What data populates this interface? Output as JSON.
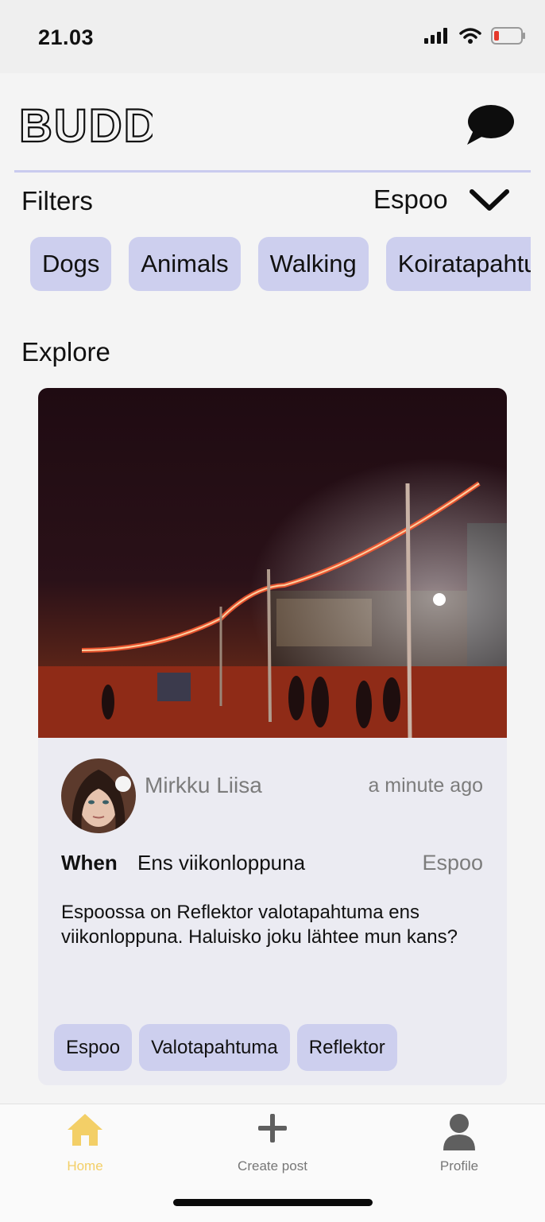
{
  "status_bar": {
    "time": "21.03",
    "icons": [
      "cellular-signal-icon",
      "wifi-icon",
      "battery-low-icon"
    ]
  },
  "header": {
    "logo_text": "BUDDY",
    "chat_icon": "chat-bubble-icon"
  },
  "filters": {
    "label": "Filters",
    "location": "Espoo",
    "chips": [
      "Dogs",
      "Animals",
      "Walking",
      "Koiratapahtuma"
    ]
  },
  "explore": {
    "label": "Explore",
    "post": {
      "image": "night-street-lights-photo",
      "author": "Mirkku Liisa",
      "time_ago": "a minute ago",
      "when_label": "When",
      "when_value": "Ens viikonloppuna",
      "location": "Espoo",
      "text": "Espoossa on Reflektor valotapahtuma ens viikonloppuna. Haluisko joku lähtee mun kans?",
      "tags": [
        "Espoo",
        "Valotapahtuma",
        "Reflektor"
      ]
    }
  },
  "tab_bar": {
    "home": "Home",
    "create": "Create post",
    "profile": "Profile"
  },
  "colors": {
    "accent": "#cdcfee",
    "home_active": "#f3cf67",
    "divider": "#c9cbee"
  }
}
